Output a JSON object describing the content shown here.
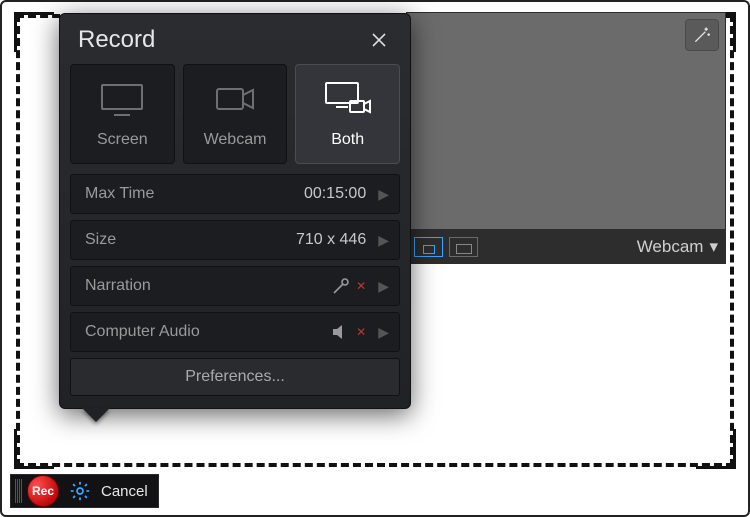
{
  "popover": {
    "title": "Record",
    "modes": [
      {
        "label": "Screen",
        "icon": "monitor-icon"
      },
      {
        "label": "Webcam",
        "icon": "camera-icon"
      },
      {
        "label": "Both",
        "icon": "monitor-camera-icon",
        "selected": true
      }
    ],
    "settings": {
      "max_time_label": "Max Time",
      "max_time_value": "00:15:00",
      "size_label": "Size",
      "size_value": "710 x 446",
      "narration_label": "Narration",
      "narration_status": "off",
      "computer_audio_label": "Computer Audio",
      "computer_audio_status": "off"
    },
    "preferences_label": "Preferences..."
  },
  "webcam_panel": {
    "dropdown_label": "Webcam"
  },
  "toolbar": {
    "rec_label": "Rec",
    "cancel_label": "Cancel"
  },
  "colors": {
    "accent_blue": "#3aa2ff",
    "rec_red": "#c40a0a",
    "error_red": "#b83a31"
  }
}
